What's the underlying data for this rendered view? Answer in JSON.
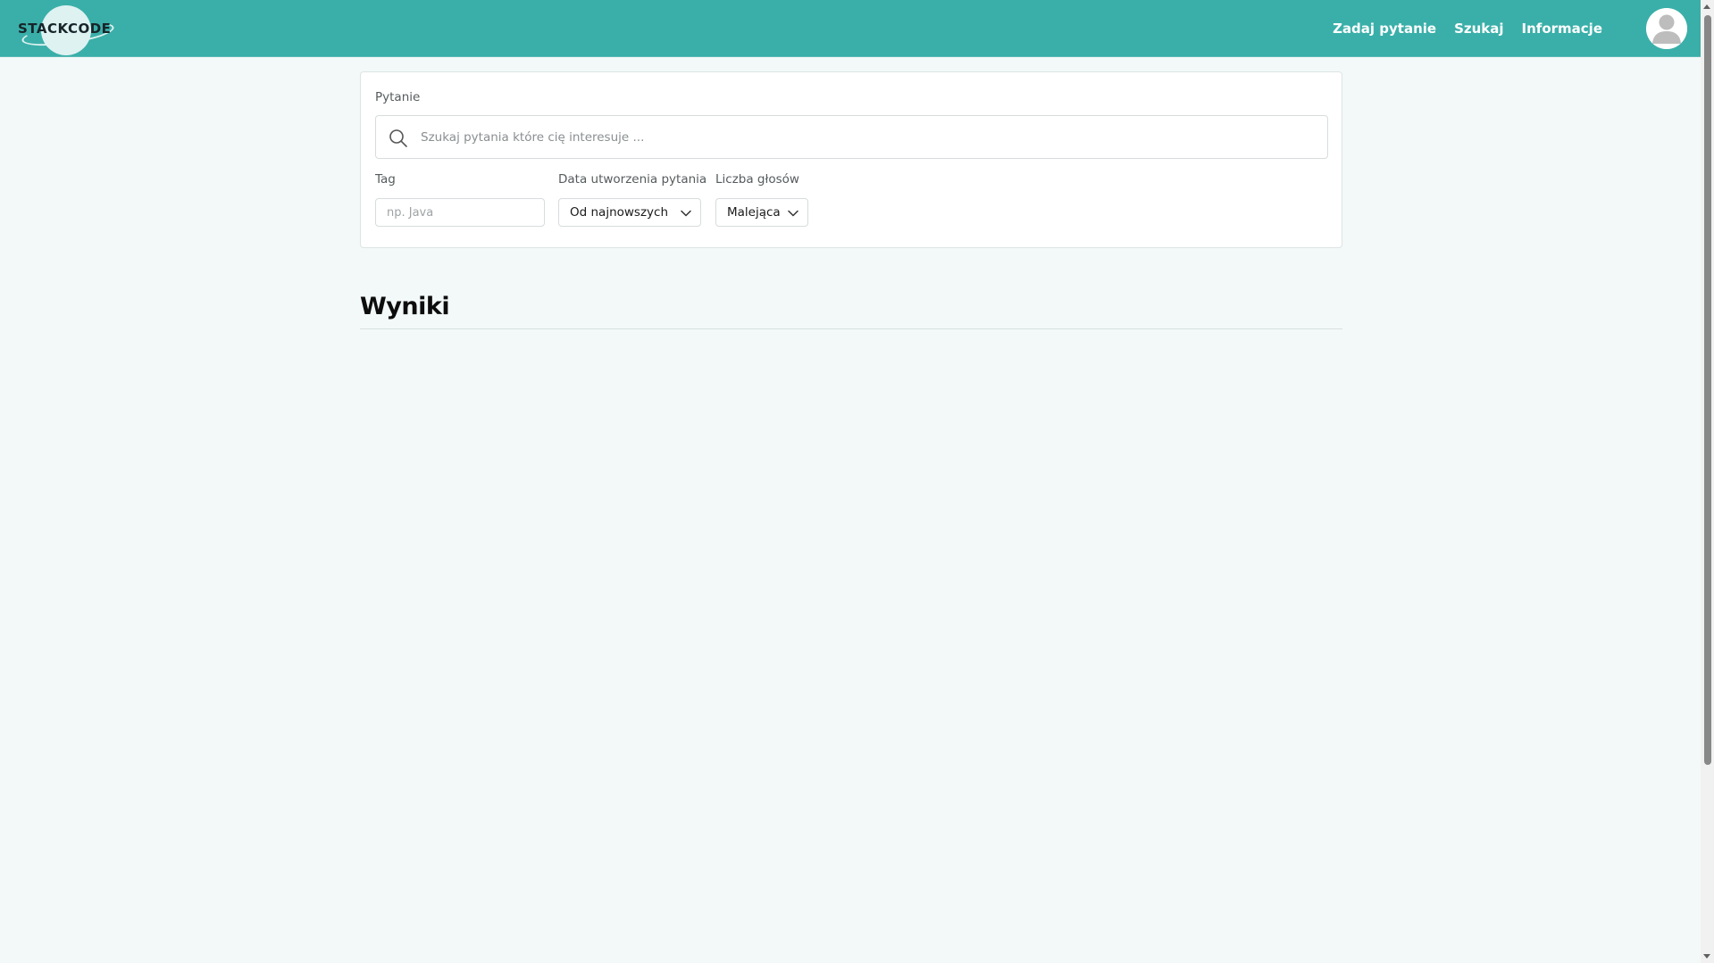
{
  "header": {
    "logo_text": "STACKCODE",
    "nav": [
      {
        "label": "Zadaj pytanie"
      },
      {
        "label": "Szukaj"
      },
      {
        "label": "Informacje"
      }
    ]
  },
  "filters": {
    "question_label": "Pytanie",
    "search_placeholder": "Szukaj pytania które cię interesuje ...",
    "tag_label": "Tag",
    "tag_placeholder": "np. Java",
    "date_label": "Data utworzenia pytania",
    "date_value": "Od najnowszych",
    "votes_label": "Liczba głosów",
    "votes_value": "Malejąca"
  },
  "results": {
    "title": "Wyniki"
  },
  "colors": {
    "header_bg": "#3aafa9",
    "page_bg": "#f2f9f8",
    "card_bg": "#ffffff",
    "logo_text": "#17252a"
  },
  "icons": {
    "search": "search-icon",
    "chevron": "chevron-down-icon",
    "avatar": "user-avatar-icon"
  }
}
